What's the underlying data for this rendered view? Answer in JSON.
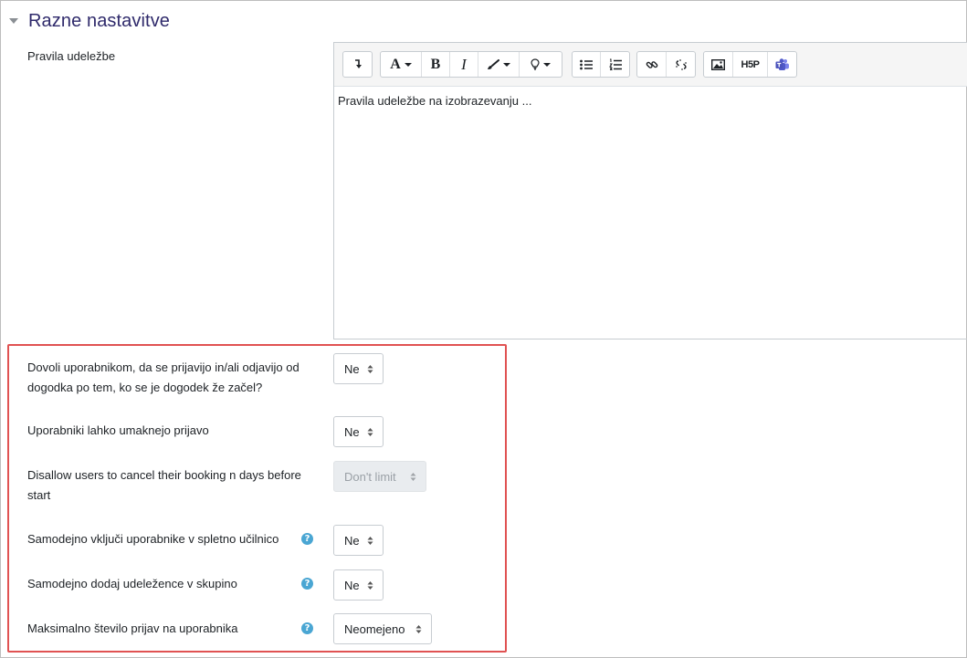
{
  "section": {
    "title": "Razne nastavitve"
  },
  "editor": {
    "label": "Pravila udeležbe",
    "content": "Pravila udeležbe na izobrazevanju ...",
    "toolbar": {
      "groups": [
        [
          "expand-icon"
        ],
        [
          "font-style-icon",
          "bold-icon",
          "italic-icon",
          "brush-icon",
          "lightbulb-icon"
        ],
        [
          "unordered-list-icon",
          "ordered-list-icon"
        ],
        [
          "link-icon",
          "unlink-icon"
        ],
        [
          "image-icon",
          "h5p-icon",
          "teams-icon"
        ]
      ],
      "h5p_label": "H5P"
    }
  },
  "settings": [
    {
      "label": "Dovoli uporabnikom, da se prijavijo in/ali odjavijo od dogodka po tem, ko se je dogodek že začel?",
      "value": "Ne",
      "help": false,
      "disabled": false
    },
    {
      "label": "Uporabniki lahko umaknejo prijavo",
      "value": "Ne",
      "help": false,
      "disabled": false
    },
    {
      "label": "Disallow users to cancel their booking n days before start",
      "value": "Don't limit",
      "help": false,
      "disabled": true
    },
    {
      "label": "Samodejno vključi uporabnike v spletno učilnico",
      "value": "Ne",
      "help": true,
      "disabled": false
    },
    {
      "label": "Samodejno dodaj udeležence v skupino",
      "value": "Ne",
      "help": true,
      "disabled": false
    },
    {
      "label": "Maksimalno število prijav na uporabnika",
      "value": "Neomejeno",
      "help": true,
      "disabled": false
    }
  ],
  "colors": {
    "section_title": "#2f2a6b",
    "highlight": "#e05252",
    "help_icon": "#4aa6d3"
  }
}
